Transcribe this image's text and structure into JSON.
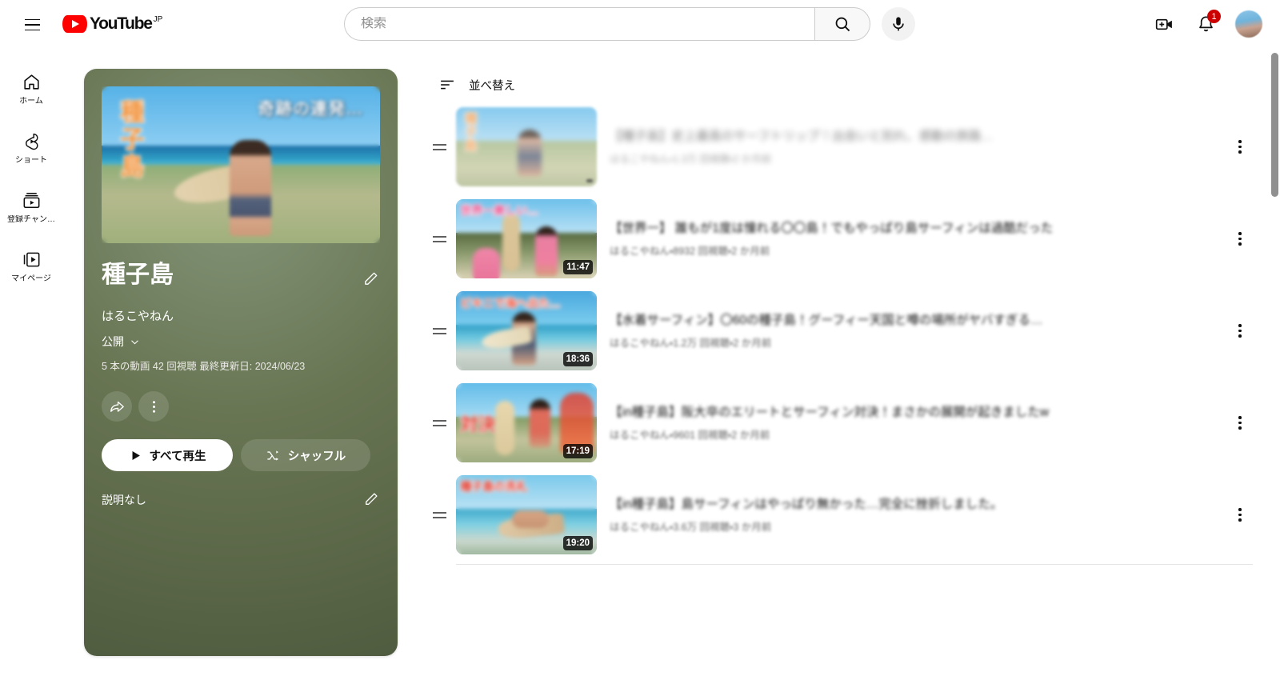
{
  "header": {
    "menu_icon": "hamburger-icon",
    "logo_text": "YouTube",
    "logo_country": "JP",
    "search": {
      "value": "",
      "placeholder": "検索",
      "search_icon": "search-icon",
      "mic_icon": "microphone-icon"
    },
    "create_icon": "create-video-icon",
    "notifications_icon": "bell-icon",
    "notifications_count": "1",
    "avatar_icon": "avatar"
  },
  "sidebar": {
    "items": [
      {
        "label": "ホーム",
        "icon": "home-icon"
      },
      {
        "label": "ショート",
        "icon": "shorts-icon"
      },
      {
        "label": "登録チャン…",
        "icon": "subscriptions-icon"
      },
      {
        "label": "マイページ",
        "icon": "you-library-icon"
      }
    ]
  },
  "playlist": {
    "title": "種子島",
    "owner": "はるこやねん",
    "privacy": "公開",
    "privacy_chevron": "chevron-down-icon",
    "stats": "5 本の動画  42 回視聴  最終更新日: 2024/06/23",
    "edit_title_icon": "pencil-icon",
    "share_icon": "share-icon",
    "more_icon": "more-vertical-icon",
    "play_all_label": "すべて再生",
    "play_all_icon": "play-icon",
    "shuffle_label": "シャッフル",
    "shuffle_icon": "shuffle-icon",
    "description": "説明なし",
    "edit_description_icon": "pencil-icon",
    "cover": {
      "text_top": "奇跡の連発…",
      "text_left": "種子島"
    }
  },
  "list": {
    "sort_label": "並べ替え",
    "sort_icon": "sort-icon",
    "videos": [
      {
        "title": "【種子島】史上最高のサーフトリップ！出会いと別れ、感動の旅路…",
        "subtitle": "はるこやねん・1.3万 回視聴・2 か月前",
        "duration": "",
        "thumb_text": "",
        "blurred": true
      },
      {
        "title": "【世界一】 誰もが1度は憧れる〇〇島！でもやっぱり島サーフィンは過酷だった",
        "subtitle": "はるこやねん・8932 回視聴・2 か月前",
        "duration": "11:47",
        "thumb_text": "世界一美しい…",
        "blurred": false
      },
      {
        "title": "【水着サーフィン】〇60の種子島！グーフィー天国と噂の場所がヤバすぎる…",
        "subtitle": "はるこやねん・1.2万 回視聴・2 か月前",
        "duration": "18:36",
        "thumb_text": "ビキニで海へ出た…",
        "blurred": false
      },
      {
        "title": "【in種子島】阪大卒のエリートとサーフィン対決！まさかの展開が起きましたw",
        "subtitle": "はるこやねん・9601 回視聴・2 か月前",
        "duration": "17:19",
        "thumb_text": "対決",
        "blurred": false
      },
      {
        "title": "【in種子島】島サーフィンはやっぱり無かった…完全に挫折しました。",
        "subtitle": "はるこやねん・3.6万 回視聴・3 か月前",
        "duration": "19:20",
        "thumb_text": "種子島の洗礼",
        "blurred": false
      }
    ]
  }
}
